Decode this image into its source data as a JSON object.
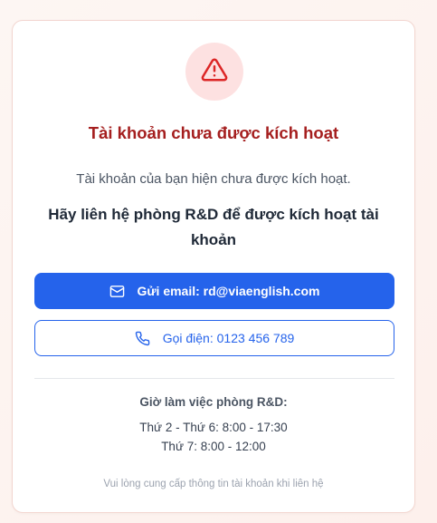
{
  "alert": {
    "icon": "warning-triangle-icon",
    "icon_color": "#dc2626",
    "icon_bg": "#fde1e1",
    "title": "Tài khoản chưa được kích hoạt",
    "title_color": "#a51f1f",
    "description": "Tài khoản của bạn hiện chưa được kích hoạt.",
    "instruction": "Hãy liên hệ phòng R&D để được kích hoạt tài khoản"
  },
  "actions": {
    "email": {
      "icon": "mail-icon",
      "label": "Gửi email: rd@viaenglish.com"
    },
    "phone": {
      "icon": "phone-icon",
      "label": "Gọi điện: 0123 456 789"
    },
    "accent_color": "#2563eb"
  },
  "hours": {
    "title": "Giờ làm việc phòng R&D:",
    "lines": [
      "Thứ 2 - Thứ 6: 8:00 - 17:30",
      "Thứ 7: 8:00 - 12:00"
    ]
  },
  "footer_note": "Vui lòng cung cấp thông tin tài khoản khi liên hệ"
}
